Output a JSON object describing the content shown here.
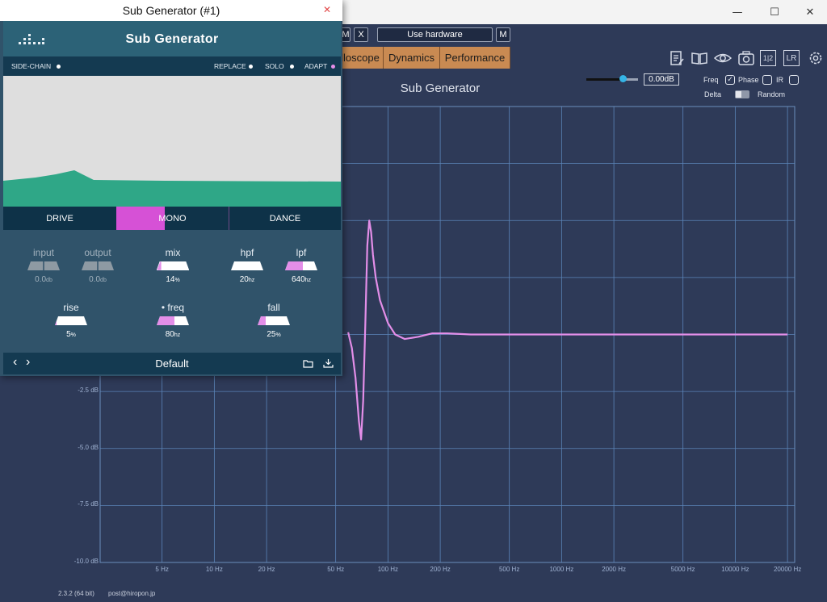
{
  "host": {
    "window_controls": {
      "minimize": "—",
      "maximize": "☐",
      "close": "✕"
    },
    "toolbar": {
      "m_label": "M",
      "x_label": "X",
      "hardware_label": "Use hardware",
      "m2_label": "M"
    },
    "tabs": [
      {
        "label": "lloscope"
      },
      {
        "label": "Dynamics"
      },
      {
        "label": "Performance"
      }
    ],
    "tool_icons": [
      "notes-icon",
      "book-icon",
      "eye-icon",
      "camera-icon",
      "channel-split-icon",
      "lr-icon",
      "gear-icon"
    ],
    "channel_split_label": "1|2",
    "lr_label": "LR",
    "analyzer_title": "Sub Generator",
    "volume": {
      "readout": "0.00dB",
      "level": 0.7
    },
    "options": {
      "freq": "Freq",
      "freq_checked": true,
      "phase": "Phase",
      "phase_checked": false,
      "ir": "IR",
      "ir_checked": false,
      "delta": "Delta",
      "random": "Random"
    },
    "footer": {
      "version": "2.3.2 (64 bit)",
      "email": "post@hiropon.jp"
    },
    "colors": {
      "background": "#2e3a58",
      "grid": "#5b84b8",
      "curve": "#e38ee8",
      "tab": "#c98a52"
    }
  },
  "chart_data": {
    "type": "line",
    "title": "Sub Generator",
    "y_ticks": [
      "-2.5 dB",
      "-5.0 dB",
      "-7.5 dB",
      "-10.0 dB"
    ],
    "x_ticks": [
      "5 Hz",
      "10 Hz",
      "20 Hz",
      "50 Hz",
      "100 Hz",
      "200 Hz",
      "500 Hz",
      "1000 Hz",
      "2000 Hz",
      "5000 Hz",
      "10000 Hz",
      "20000 Hz"
    ],
    "x_tick_values": [
      5,
      10,
      20,
      50,
      100,
      200,
      500,
      1000,
      2000,
      5000,
      10000,
      20000
    ],
    "xlim": [
      2.2,
      22000
    ],
    "ylim": [
      -10,
      10
    ],
    "x_scale": "log",
    "grid": true,
    "series": [
      {
        "x": [
          59,
          62,
          65,
          68,
          70,
          72,
          74,
          76,
          78,
          80,
          82,
          85,
          90,
          100,
          110,
          125,
          150,
          180,
          220,
          300,
          400,
          600,
          1000,
          2000,
          5000,
          10000,
          20000
        ],
        "y": [
          0.1,
          -0.6,
          -1.9,
          -3.8,
          -4.6,
          -2.9,
          0.4,
          3.9,
          5.0,
          4.5,
          3.5,
          2.5,
          1.5,
          0.5,
          0.0,
          -0.2,
          -0.1,
          0.05,
          0.05,
          0.0,
          0.0,
          0.0,
          0.0,
          0.0,
          0.0,
          0.0,
          0.0
        ]
      }
    ]
  },
  "plugin": {
    "window_title": "Sub Generator (#1)",
    "close_label": "✕",
    "name": "Sub Generator",
    "routing": {
      "sidechain": "SIDE-CHAIN",
      "replace": "REPLACE",
      "solo": "SOLO",
      "adapt": "ADAPT"
    },
    "modes": {
      "drive": "DRIVE",
      "mono": "MONO",
      "dance": "DANCE"
    },
    "params": {
      "input": {
        "label": "input",
        "value": "0.0",
        "unit": "db"
      },
      "output": {
        "label": "output",
        "value": "0.0",
        "unit": "db"
      },
      "mix": {
        "label": "mix",
        "value": "14",
        "unit": "%",
        "level": 0.14
      },
      "hpf": {
        "label": "hpf",
        "value": "20",
        "unit": "hz",
        "level": 0.0
      },
      "lpf": {
        "label": "lpf",
        "value": "640",
        "unit": "hz",
        "level": 0.55
      },
      "rise": {
        "label": "rise",
        "value": "5",
        "unit": "%",
        "level": 0.05
      },
      "freq": {
        "label": "• freq",
        "value": "80",
        "unit": "hz",
        "level": 0.55
      },
      "fall": {
        "label": "fall",
        "value": "25",
        "unit": "%",
        "level": 0.25
      }
    },
    "preset": {
      "name": "Default",
      "prev": "‹",
      "next": "›"
    },
    "colors": {
      "accent": "#d651d6",
      "wave": "#2fa787",
      "panel": "#30536a",
      "bar": "#143a51"
    }
  }
}
